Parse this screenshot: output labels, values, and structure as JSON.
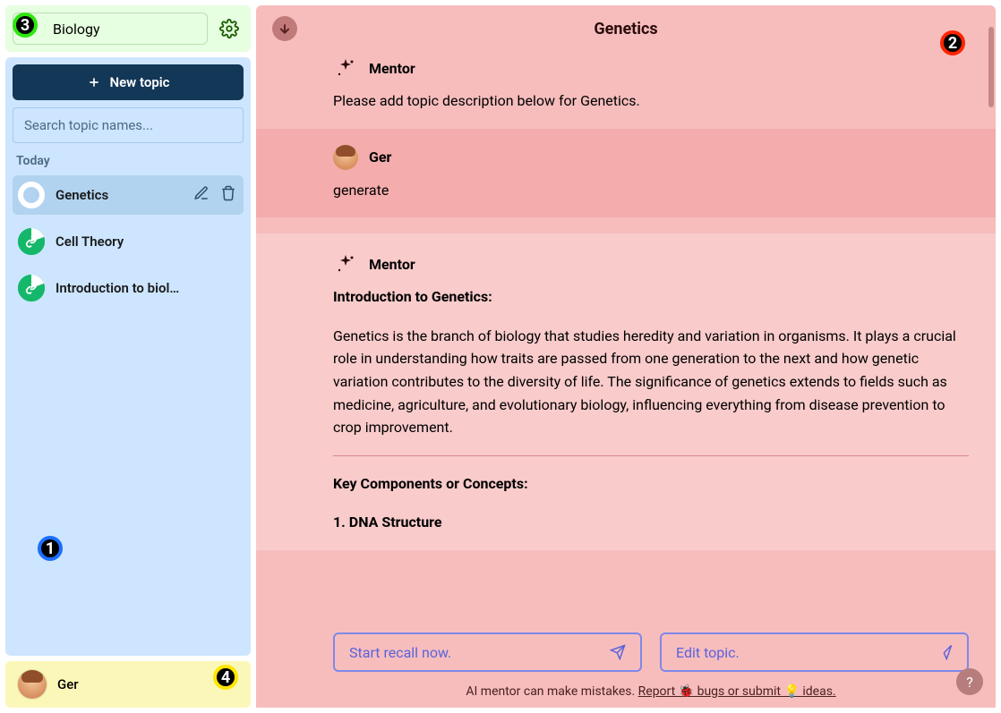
{
  "subject": {
    "selected": "Biology"
  },
  "sidebar": {
    "new_topic_label": "New topic",
    "search_placeholder": "Search topic names...",
    "group_label": "Today",
    "topics": [
      {
        "label": "Genetics"
      },
      {
        "label": "Cell Theory"
      },
      {
        "label": "Introduction to biolo..."
      }
    ]
  },
  "user": {
    "name": "Ger"
  },
  "main": {
    "title": "Genetics",
    "messages": {
      "m1": {
        "author": "Mentor",
        "text": "Please add topic description below for Genetics."
      },
      "m2": {
        "author": "Ger",
        "text": "generate"
      },
      "m3": {
        "author": "Mentor",
        "heading": "Introduction to Genetics:",
        "para": "Genetics is the branch of biology that studies heredity and variation in organisms. It plays a crucial role in understanding how traits are passed from one generation to the next and how genetic variation contributes to the diversity of life. The significance of genetics extends to fields such as medicine, agriculture, and evolutionary biology, influencing everything from disease prevention to crop improvement.",
        "sub1": "Key Components or Concepts:",
        "sub2": "1. DNA Structure"
      }
    },
    "actions": {
      "recall": "Start recall now.",
      "edit": "Edit topic."
    },
    "disclaimer_prefix": "AI mentor can make mistakes. ",
    "disclaimer_link": "Report 🐞 bugs or submit 💡 ideas."
  },
  "markers": {
    "m1": "1",
    "m2": "2",
    "m3": "3",
    "m4": "4"
  },
  "help": "?"
}
